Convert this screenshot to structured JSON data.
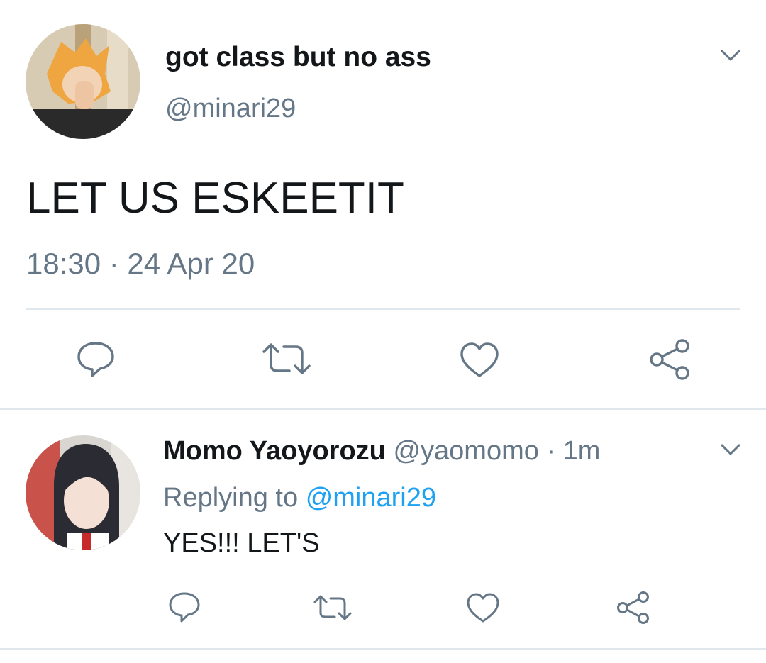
{
  "main_tweet": {
    "display_name": "got class but no ass",
    "handle": "@minari29",
    "text": "LET US ESKEETIT",
    "timestamp": "18:30 · 24 Apr 20",
    "actions": [
      "reply-icon",
      "retweet-icon",
      "like-icon",
      "share-icon"
    ]
  },
  "reply_tweet": {
    "display_name": "Momo Yaoyorozu",
    "handle": "@yaomomo",
    "time": "· 1m",
    "replying_prefix": "Replying to",
    "replying_handle": "@minari29",
    "text": "YES!!! LET'S",
    "actions": [
      "reply-icon",
      "retweet-icon",
      "like-icon",
      "share-icon"
    ]
  },
  "colors": {
    "text": "#14171a",
    "muted": "#657786",
    "link": "#1da1f2",
    "divider": "#e1e8ed"
  }
}
